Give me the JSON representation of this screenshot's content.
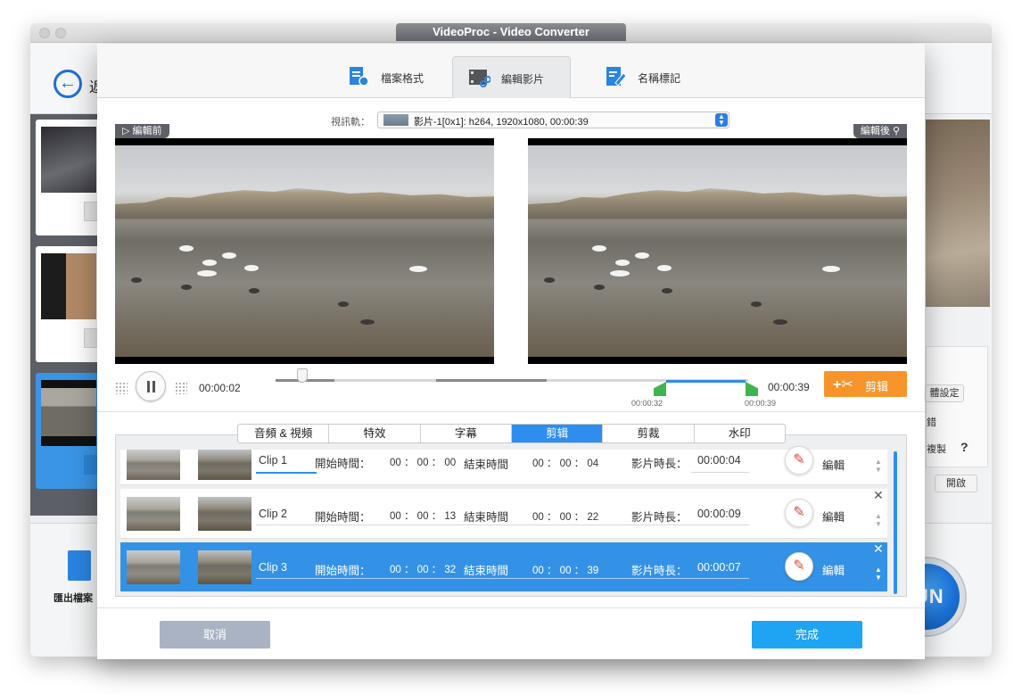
{
  "app": {
    "window_title": "VideoProc - Video Converter"
  },
  "background": {
    "back_label": "返",
    "export_label": "匯出檔案",
    "right_panel": {
      "settings_btn": "體設定",
      "label_a": "錯",
      "label_b": "複製",
      "help": "?",
      "open_btn": "開啟"
    },
    "run_label": "RUN"
  },
  "dialog": {
    "tabs": [
      {
        "label": "檔案格式",
        "icon": "file-format-icon"
      },
      {
        "label": "編輯影片",
        "icon": "edit-video-icon"
      },
      {
        "label": "名稱標記",
        "icon": "rename-icon"
      }
    ],
    "track": {
      "label": "視訊軌：",
      "value": "影片-1[0x1]: h264, 1920x1080, 00:00:39"
    },
    "preview_before": "▷ 編輯前",
    "preview_after": "編輯後",
    "playback": {
      "current_time": "00:00:02",
      "end_time": "00:00:39",
      "marker_start": "00:00:32",
      "marker_end": "00:00:39"
    },
    "cut_button": "剪辑",
    "subtabs": [
      "音頻 & 視頻",
      "特效",
      "字幕",
      "剪辑",
      "剪裁",
      "水印"
    ],
    "clips": [
      {
        "name": "Clip 1",
        "start_label": "開始時間：",
        "start": "00 ： 00 ： 00",
        "end_label": "結束時間",
        "end": "00 ： 00 ： 04",
        "dur_label": "影片時長：",
        "duration": "00:00:04",
        "edit": "編輯"
      },
      {
        "name": "Clip 2",
        "start_label": "開始時間：",
        "start": "00 ： 00 ： 13",
        "end_label": "結束時間",
        "end": "00 ： 00 ： 22",
        "dur_label": "影片時長：",
        "duration": "00:00:09",
        "edit": "編輯"
      },
      {
        "name": "Clip 3",
        "start_label": "開始時間：",
        "start": "00 ： 00 ： 32",
        "end_label": "結束時間",
        "end": "00 ： 00 ： 39",
        "dur_label": "影片時長：",
        "duration": "00:00:07",
        "edit": "編輯"
      }
    ],
    "cancel": "取消",
    "done": "完成"
  },
  "colors": {
    "accent": "#2e8ef0",
    "cut": "#f7952a",
    "marker": "#3fb34f",
    "done": "#1ea4f2"
  }
}
